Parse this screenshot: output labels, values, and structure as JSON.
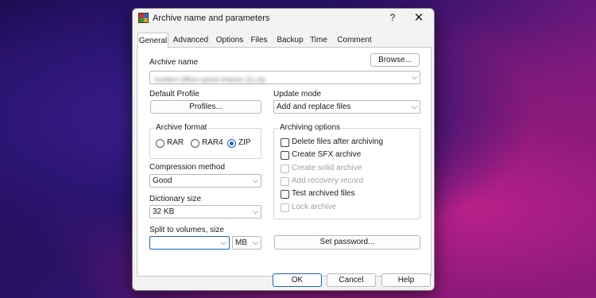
{
  "dialog": {
    "title": "Archive name and parameters",
    "help_glyph": "?",
    "close_glyph": "✕"
  },
  "tabs": [
    "General",
    "Advanced",
    "Options",
    "Files",
    "Backup",
    "Time",
    "Comment"
  ],
  "general": {
    "archive_name_label": "Archive name",
    "browse_label": "Browse...",
    "archive_name_value": "modern-office-space-interior (1).zip",
    "default_profile_label": "Default Profile",
    "profiles_label": "Profiles...",
    "update_mode_label": "Update mode",
    "update_mode_value": "Add and replace files",
    "archive_format": {
      "title": "Archive format",
      "options": [
        "RAR",
        "RAR4",
        "ZIP"
      ],
      "selected": "ZIP"
    },
    "compression_method_label": "Compression method",
    "compression_method_value": "Good",
    "dictionary_size_label": "Dictionary size",
    "dictionary_size_value": "32 KB",
    "split_label": "Split to volumes, size",
    "split_value": "",
    "split_unit": "MB",
    "archiving_options": {
      "title": "Archiving options",
      "items": [
        {
          "label": "Delete files after archiving",
          "checked": false,
          "enabled": true
        },
        {
          "label": "Create SFX archive",
          "checked": false,
          "enabled": true
        },
        {
          "label": "Create solid archive",
          "checked": false,
          "enabled": false
        },
        {
          "label": "Add recovery record",
          "checked": false,
          "enabled": false
        },
        {
          "label": "Test archived files",
          "checked": false,
          "enabled": true
        },
        {
          "label": "Lock archive",
          "checked": false,
          "enabled": false
        }
      ]
    },
    "set_password_label": "Set password..."
  },
  "footer": {
    "ok_label": "OK",
    "cancel_label": "Cancel",
    "help_label": "Help"
  },
  "colors": {
    "accent": "#1a63c4",
    "dialog_bg": "#f3f3f3",
    "panel_bg": "#ffffff"
  }
}
